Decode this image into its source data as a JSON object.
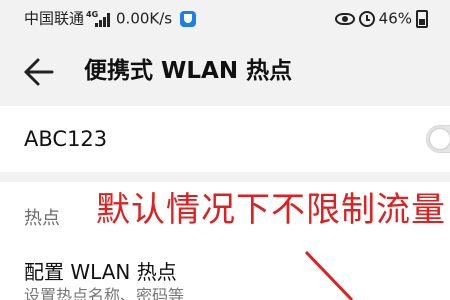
{
  "status_bar": {
    "carrier": "中国联通",
    "network": "4G",
    "speed": "0.00K/s",
    "battery": "46%",
    "battery_level": 0.46
  },
  "header": {
    "title": "便携式 WLAN 热点"
  },
  "ssid_card": {
    "ssid": "ABC123",
    "toggle_on": false
  },
  "section": {
    "label": "热点",
    "item_title": "配置 WLAN 热点",
    "item_subtitle": "设置热点名称、密码等"
  },
  "annotation": {
    "text": "默认情况下不限制流量",
    "color": "#e02020"
  },
  "icons": {
    "back": "back-arrow-icon",
    "eye": "eye-icon",
    "alarm": "alarm-icon",
    "battery": "battery-icon",
    "shield": "shield-icon"
  }
}
